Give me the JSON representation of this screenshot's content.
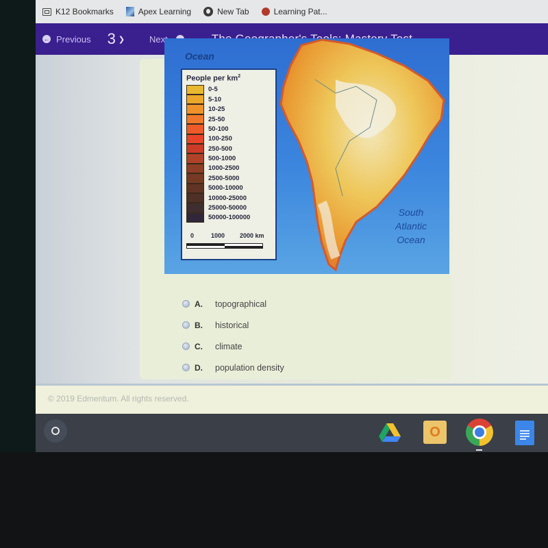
{
  "bookmarks": [
    {
      "label": "K12 Bookmarks",
      "icon": "folder-icon"
    },
    {
      "label": "Apex Learning",
      "icon": "apex-icon"
    },
    {
      "label": "New Tab",
      "icon": "globe-icon"
    },
    {
      "label": "Learning Pat...",
      "icon": "learning-path-icon"
    }
  ],
  "nav": {
    "previous_label": "Previous",
    "question_number": "3",
    "next_label": "Next",
    "title": "The Geographer's Tools: Mastery Test"
  },
  "map": {
    "ocean_top_label": "Ocean",
    "ocean_sa_label": [
      "South",
      "Atlantic",
      "Ocean"
    ],
    "legend_title": "People per km",
    "legend_title_sup": "2",
    "legend": [
      {
        "label": "0-5",
        "color": "#e8b830"
      },
      {
        "label": "5-10",
        "color": "#eca62a"
      },
      {
        "label": "10-25",
        "color": "#ee922a"
      },
      {
        "label": "25-50",
        "color": "#f0782a"
      },
      {
        "label": "50-100",
        "color": "#ef5a2a"
      },
      {
        "label": "100-250",
        "color": "#e8442a"
      },
      {
        "label": "250-500",
        "color": "#cc3a28"
      },
      {
        "label": "500-1000",
        "color": "#b0422a"
      },
      {
        "label": "1000-2500",
        "color": "#8e3e26"
      },
      {
        "label": "2500-5000",
        "color": "#763a24"
      },
      {
        "label": "5000-10000",
        "color": "#603424"
      },
      {
        "label": "10000-25000",
        "color": "#4e3026"
      },
      {
        "label": "25000-50000",
        "color": "#3e2e30"
      },
      {
        "label": "50000-100000",
        "color": "#30283a"
      }
    ],
    "scale_labels": [
      "0",
      "1000",
      "2000 km"
    ]
  },
  "question": {
    "options": [
      {
        "letter": "A.",
        "text": "topographical"
      },
      {
        "letter": "B.",
        "text": "historical"
      },
      {
        "letter": "C.",
        "text": "climate"
      },
      {
        "letter": "D.",
        "text": "population density"
      }
    ]
  },
  "footer": {
    "copyright": "© 2019 Edmentum. All rights reserved."
  },
  "shelf": {
    "apps": [
      "google-drive-icon",
      "outlook-icon",
      "chrome-icon",
      "google-docs-icon"
    ]
  }
}
